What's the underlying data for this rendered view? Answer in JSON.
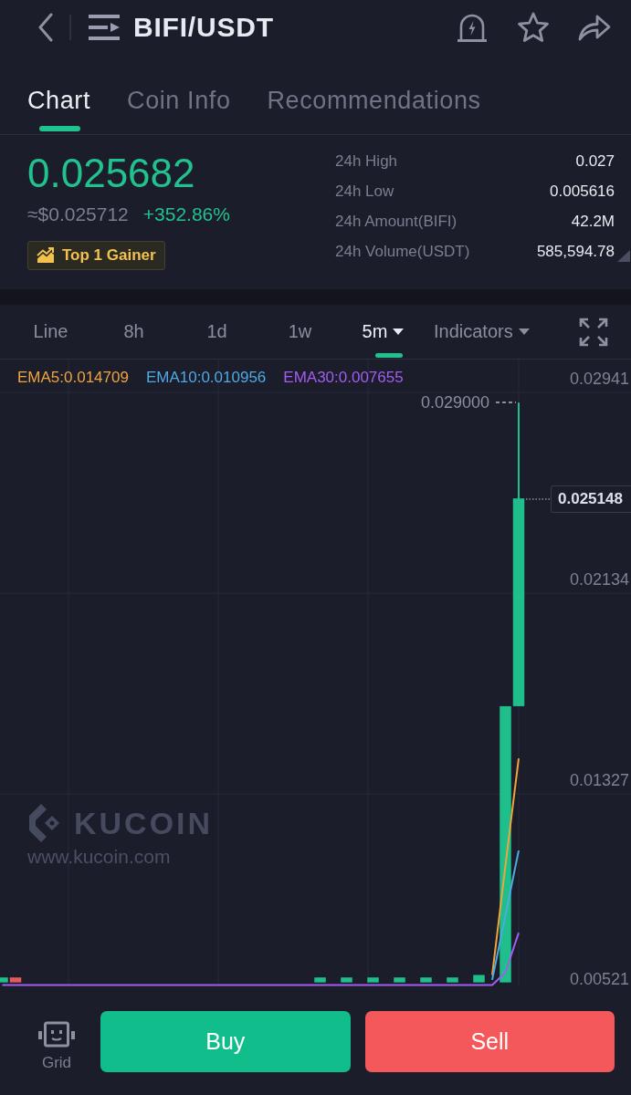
{
  "header": {
    "title": "BIFI/USDT"
  },
  "tabs": [
    {
      "label": "Chart",
      "selected": true
    },
    {
      "label": "Coin Info",
      "selected": false
    },
    {
      "label": "Recommendations",
      "selected": false
    }
  ],
  "ticker": {
    "price": "0.025682",
    "fiat_price": "≈$0.025712",
    "change": "+352.86%",
    "badge": "Top 1 Gainer"
  },
  "stats": [
    {
      "label": "24h High",
      "value": "0.027"
    },
    {
      "label": "24h Low",
      "value": "0.005616"
    },
    {
      "label": "24h Amount(BIFI)",
      "value": "42.2M"
    },
    {
      "label": "24h Volume(USDT)",
      "value": "585,594.78"
    }
  ],
  "intervals": [
    {
      "label": "Line",
      "selected": false,
      "dropdown": false
    },
    {
      "label": "8h",
      "selected": false,
      "dropdown": false
    },
    {
      "label": "1d",
      "selected": false,
      "dropdown": false
    },
    {
      "label": "1w",
      "selected": false,
      "dropdown": false
    },
    {
      "label": "5m",
      "selected": true,
      "dropdown": true
    },
    {
      "label": "Indicators",
      "selected": false,
      "dropdown": true
    }
  ],
  "chart": {
    "high_label": "0.029000",
    "last_price_label": "0.025148",
    "watermark": {
      "brand": "KUCOIN",
      "url": "www.kucoin.com"
    },
    "chart_data": {
      "type": "line",
      "grid": true,
      "ylim": [
        0.00521,
        0.02941
      ],
      "yticks": [
        {
          "value": 0.02941,
          "label": "0.02941"
        },
        {
          "value": 0.02134,
          "label": "0.02134"
        },
        {
          "value": 0.01327,
          "label": "0.01327"
        },
        {
          "value": 0.00521,
          "label": "0.00521"
        }
      ],
      "series": [
        {
          "type": "candlestick",
          "ohlc": [
            [
              0.0057,
              0.0059,
              0.0057,
              0.0059
            ],
            [
              0.0059,
              0.0059,
              0.0057,
              0.0057
            ],
            null,
            null,
            null,
            null,
            null,
            null,
            null,
            null,
            null,
            null,
            null,
            null,
            null,
            null,
            null,
            null,
            null,
            null,
            null,
            null,
            null,
            null,
            [
              0.0057,
              0.0059,
              0.0057,
              0.0059
            ],
            null,
            [
              0.0057,
              0.0059,
              0.0057,
              0.0059
            ],
            null,
            [
              0.0057,
              0.0059,
              0.0057,
              0.0059
            ],
            null,
            [
              0.0057,
              0.0059,
              0.0057,
              0.0059
            ],
            null,
            [
              0.0057,
              0.0059,
              0.0057,
              0.0059
            ],
            null,
            [
              0.0057,
              0.0059,
              0.0057,
              0.0059
            ],
            null,
            [
              0.0057,
              0.006,
              0.0057,
              0.006
            ],
            null,
            [
              0.0057,
              0.0168,
              0.0057,
              0.0168
            ],
            [
              0.0168,
              0.029,
              0.0168,
              0.02515
            ]
          ]
        },
        {
          "name": "EMA5:0.014709",
          "color": "#f0a43a",
          "values": [
            null,
            null,
            null,
            null,
            null,
            null,
            null,
            null,
            null,
            null,
            null,
            null,
            null,
            null,
            null,
            null,
            null,
            null,
            null,
            null,
            null,
            null,
            null,
            null,
            null,
            null,
            null,
            null,
            null,
            null,
            null,
            null,
            null,
            null,
            null,
            null,
            null,
            0.006,
            0.0104,
            0.0147
          ]
        },
        {
          "name": "EMA10:0.010956",
          "color": "#4fa9e3",
          "values": [
            null,
            null,
            null,
            null,
            null,
            null,
            null,
            null,
            null,
            null,
            null,
            null,
            null,
            null,
            null,
            null,
            null,
            null,
            null,
            null,
            null,
            null,
            null,
            null,
            null,
            null,
            null,
            null,
            null,
            null,
            null,
            null,
            null,
            null,
            null,
            null,
            null,
            0.0058,
            0.0084,
            0.011
          ]
        },
        {
          "name": "EMA30:0.007655",
          "color": "#a35cf0",
          "values": [
            0.0056,
            0.0056,
            0.0056,
            0.0056,
            0.0056,
            0.0056,
            0.0056,
            0.0056,
            0.0056,
            0.0056,
            0.0056,
            0.0056,
            0.0056,
            0.0056,
            0.0056,
            0.0056,
            0.0056,
            0.0056,
            0.0056,
            0.0056,
            0.0056,
            0.0056,
            0.0056,
            0.0056,
            0.0056,
            0.0056,
            0.0056,
            0.0056,
            0.0056,
            0.0056,
            0.0056,
            0.0056,
            0.0056,
            0.0056,
            0.0056,
            0.0056,
            0.0056,
            0.0056,
            0.0061,
            0.0077
          ]
        }
      ]
    }
  },
  "bottom_bar": {
    "grid_label": "Grid",
    "buttons": [
      {
        "label": "Buy",
        "kind": "buy"
      },
      {
        "label": "Sell",
        "kind": "sell"
      }
    ]
  }
}
